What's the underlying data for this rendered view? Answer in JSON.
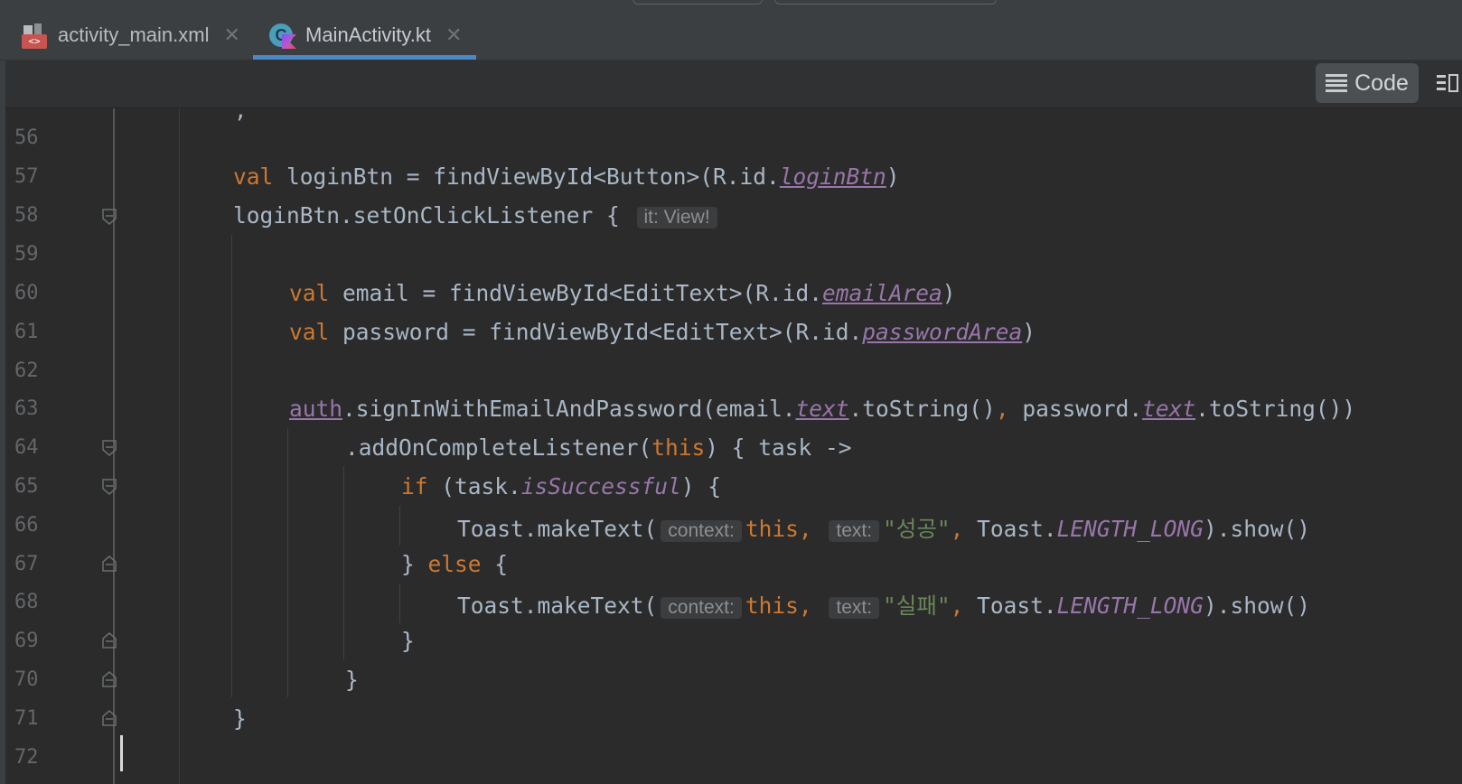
{
  "tabs": [
    {
      "label": "activity_main.xml",
      "icon": "xml-layout-file-icon",
      "active": false
    },
    {
      "label": "MainActivity.kt",
      "icon": "kotlin-class-file-icon",
      "active": true
    }
  ],
  "toolbar": {
    "code_label": "Code"
  },
  "editor": {
    "line_numbers": [
      "56",
      "57",
      "58",
      "59",
      "60",
      "61",
      "62",
      "63",
      "64",
      "65",
      "66",
      "67",
      "68",
      "69",
      "70",
      "71",
      "72"
    ],
    "l57": {
      "kw": "val",
      "a": " loginBtn = findViewById<Button>(R.id.",
      "prop": "loginBtn",
      "b": ")"
    },
    "l58": {
      "a": "loginBtn.setOnClickListener { ",
      "hint": "it: View!"
    },
    "l60": {
      "kw": "val",
      "a": " email = findViewById<EditText>(R.id.",
      "prop": "emailArea",
      "b": ")"
    },
    "l61": {
      "kw": "val",
      "a": " password = findViewById<EditText>(R.id.",
      "prop": "passwordArea",
      "b": ")"
    },
    "l63": {
      "prop1": "auth",
      "a": ".signInWithEmailAndPassword(email.",
      "prop2": "text",
      "b": ".toString()",
      "comma": ",",
      "c": " password.",
      "prop3": "text",
      "d": ".toString())"
    },
    "l64": {
      "a": ".addOnCompleteListener(",
      "kw": "this",
      "b": ") { task ->"
    },
    "l65": {
      "kw": "if",
      "a": " (task.",
      "prop": "isSuccessful",
      "b": ") {"
    },
    "l66": {
      "a": "Toast.makeText(",
      "hint1": "context:",
      "kw": "this",
      "comma": ",",
      "hint2": "text:",
      "str": "\"성공\"",
      "comma2": ",",
      "b": " Toast.",
      "const": "LENGTH_LONG",
      "c": ").show()"
    },
    "l67": {
      "a": "} ",
      "kw": "else",
      "b": " {"
    },
    "l68": {
      "a": "Toast.makeText(",
      "hint1": "context:",
      "kw": "this",
      "comma": ",",
      "hint2": "text:",
      "str": "\"실패\"",
      "comma2": ",",
      "b": " Toast.",
      "const": "LENGTH_LONG",
      "c": ").show()"
    },
    "l69": {
      "a": "}"
    },
    "l70": {
      "a": "}"
    },
    "l71": {
      "a": "}"
    }
  }
}
